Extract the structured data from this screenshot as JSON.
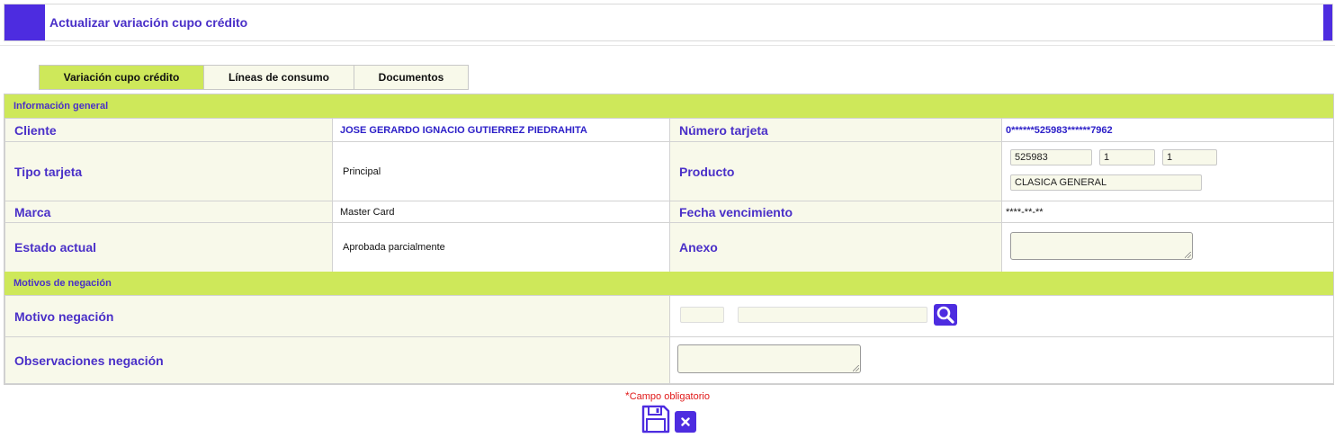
{
  "window": {
    "title": "Actualizar variación cupo crédito"
  },
  "tabs": [
    {
      "label": "Variación cupo crédito",
      "active": true
    },
    {
      "label": "Líneas de consumo",
      "active": false
    },
    {
      "label": "Documentos",
      "active": false
    }
  ],
  "info_general": {
    "header": "Información general",
    "cliente_label": "Cliente",
    "cliente_value": "JOSE GERARDO IGNACIO GUTIERREZ PIEDRAHITA",
    "numero_tarjeta_label": "Número tarjeta",
    "numero_tarjeta_value": "0******525983******7962",
    "tipo_tarjeta_label": "Tipo tarjeta",
    "tipo_tarjeta_value": "Principal",
    "producto_label": "Producto",
    "producto_fields": [
      "525983",
      "1",
      "1"
    ],
    "producto_name": "CLASICA GENERAL",
    "marca_label": "Marca",
    "marca_value": "Master Card",
    "fecha_vencimiento_label": "Fecha vencimiento",
    "fecha_vencimiento_value": "****-**-**",
    "estado_actual_label": "Estado actual",
    "estado_actual_value": "Aprobada parcialmente",
    "anexo_label": "Anexo",
    "anexo_value": ""
  },
  "motivos": {
    "header": "Motivos de negación",
    "motivo_label": "Motivo negación",
    "motivo_code": "",
    "motivo_desc": "",
    "observaciones_label": "Observaciones negación",
    "observaciones_value": ""
  },
  "footer": {
    "required_star": "*",
    "required_text": "Campo obligatorio"
  },
  "colors": {
    "accent": "#4d2ce0",
    "header_bg": "#cee85a",
    "label_bg": "#f8f9ea",
    "label_text": "#4a30c8",
    "required": "#e01818"
  },
  "icons": {
    "search": "search-icon",
    "save": "save-icon",
    "close": "close-icon"
  }
}
